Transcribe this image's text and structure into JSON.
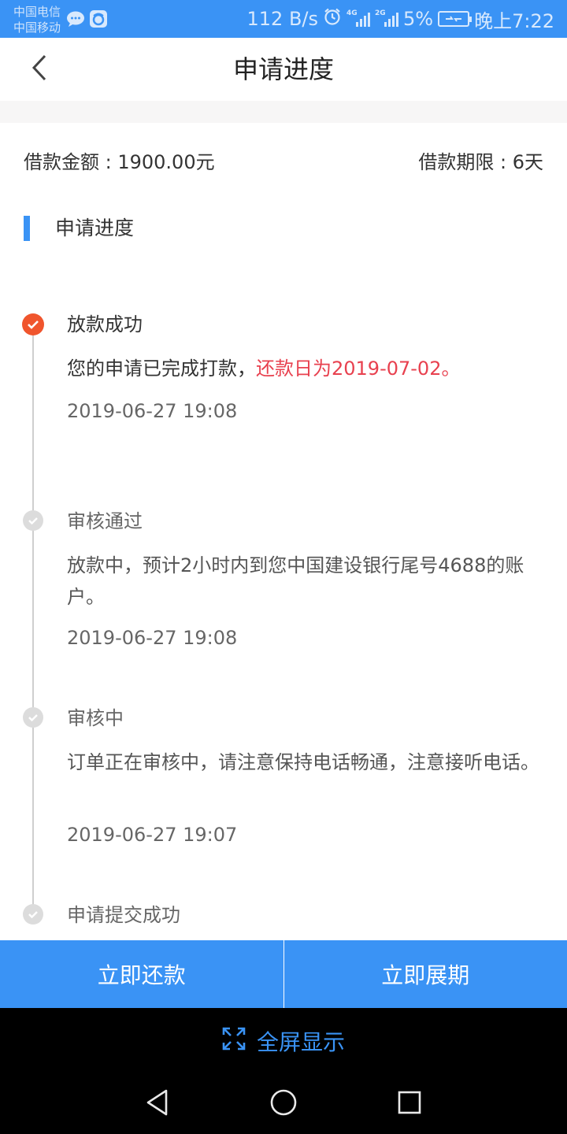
{
  "status_bar": {
    "carrier_1": "中国电信",
    "carrier_2": "中国移动",
    "net_speed": "112 B/s",
    "signal_1_label": "4G",
    "signal_2_label": "2G",
    "battery": "5%",
    "time": "晚上7:22",
    "icons": [
      "chat-icon",
      "app-icon",
      "alarm-icon",
      "signal-icon",
      "battery-charging-icon"
    ]
  },
  "header": {
    "title": "申请进度",
    "back_icon": "chevron-left-icon"
  },
  "summary": {
    "amount": "借款金额 : 1900.00元",
    "term": "借款期限 : 6天"
  },
  "section": {
    "title": "申请进度"
  },
  "timeline": [
    {
      "title": "放款成功",
      "desc": "您的申请已完成打款，",
      "desc_highlight": "还款日为2019-07-02。",
      "time": "2019-06-27 19:08"
    },
    {
      "title": "审核通过",
      "desc": "放款中，预计2小时内到您中国建设银行尾号4688的账户。",
      "time": "2019-06-27 19:08"
    },
    {
      "title": "审核中",
      "desc": "订单正在审核中，请注意保持电话畅通，注意接听电话。",
      "time": "2019-06-27 19:07"
    },
    {
      "title": "申请提交成功"
    }
  ],
  "actions": {
    "repay": "立即还款",
    "extend": "立即展期"
  },
  "fullscreen": {
    "label": "全屏显示",
    "icon": "expand-icon"
  },
  "colors": {
    "accent": "#3a93f5",
    "active_dot": "#f0552d",
    "highlight": "#e8414f"
  }
}
